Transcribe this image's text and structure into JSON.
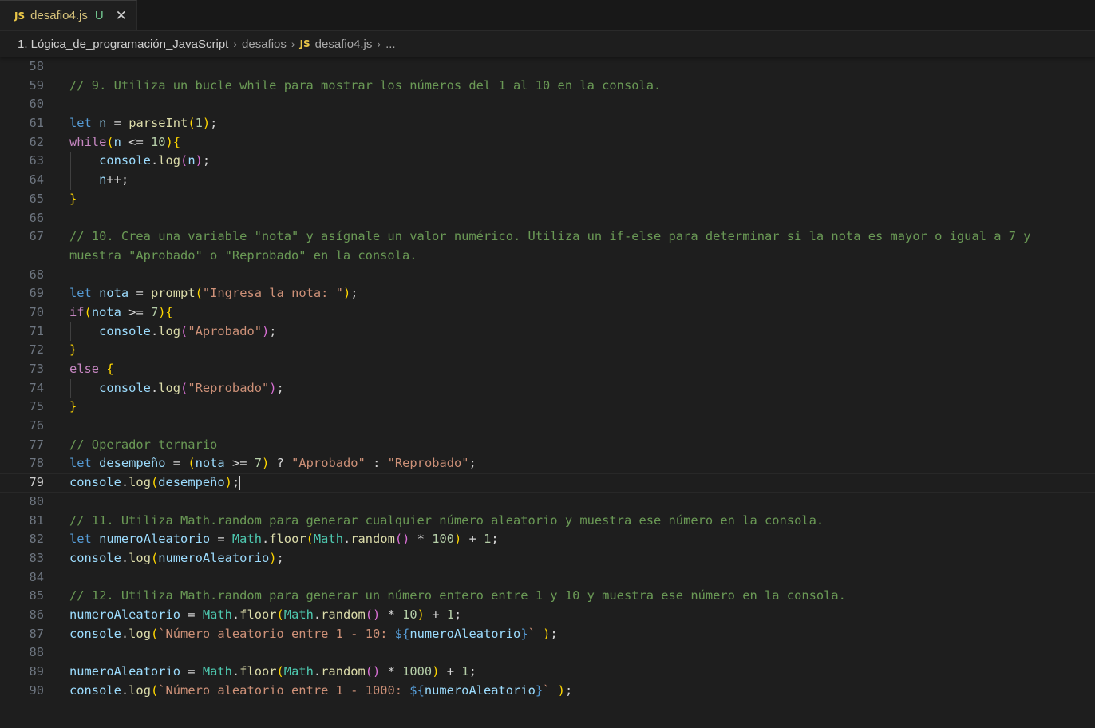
{
  "tab": {
    "icon": "js-file-icon",
    "icon_text": "JS",
    "title": "desafio4.js",
    "status": "U",
    "close_icon": "close-icon",
    "close_glyph": "✕"
  },
  "breadcrumb": {
    "items": [
      "1. Lógica_de_programación_JavaScript",
      "desafios",
      "desafio4.js",
      "..."
    ],
    "separator": "›",
    "file_icon_text": "JS"
  },
  "editor": {
    "current_line": 79,
    "lines": [
      {
        "n": "58",
        "t": []
      },
      {
        "n": "59",
        "t": [
          [
            "cm",
            "// 9. Utiliza un bucle while para mostrar los números del 1 al 10 en la consola."
          ]
        ]
      },
      {
        "n": "60",
        "t": []
      },
      {
        "n": "61",
        "t": [
          [
            "kw",
            "let"
          ],
          [
            "op",
            " "
          ],
          [
            "vr",
            "n"
          ],
          [
            "op",
            " = "
          ],
          [
            "fn",
            "parseInt"
          ],
          [
            "p1",
            "("
          ],
          [
            "nm",
            "1"
          ],
          [
            "p1",
            ")"
          ],
          [
            "op",
            ";"
          ]
        ]
      },
      {
        "n": "62",
        "t": [
          [
            "kc",
            "while"
          ],
          [
            "p1",
            "("
          ],
          [
            "vr",
            "n"
          ],
          [
            "op",
            " <= "
          ],
          [
            "nm",
            "10"
          ],
          [
            "p1",
            ")"
          ],
          [
            "p1",
            "{"
          ]
        ]
      },
      {
        "n": "63",
        "g": 1,
        "t": [
          [
            "op",
            "    "
          ],
          [
            "vr",
            "console"
          ],
          [
            "op",
            "."
          ],
          [
            "fn",
            "log"
          ],
          [
            "p2",
            "("
          ],
          [
            "vr",
            "n"
          ],
          [
            "p2",
            ")"
          ],
          [
            "op",
            ";"
          ]
        ]
      },
      {
        "n": "64",
        "g": 1,
        "t": [
          [
            "op",
            "    "
          ],
          [
            "vr",
            "n"
          ],
          [
            "op",
            "++;"
          ]
        ]
      },
      {
        "n": "65",
        "t": [
          [
            "p1",
            "}"
          ]
        ]
      },
      {
        "n": "66",
        "t": []
      },
      {
        "n": "67",
        "t": [
          [
            "cm",
            "// 10. Crea una variable \"nota\" y asígnale un valor numérico. Utiliza un if-else para determinar si la nota es mayor o igual a 7 y"
          ]
        ]
      },
      {
        "n": "",
        "t": [
          [
            "cm",
            "muestra \"Aprobado\" o \"Reprobado\" en la consola."
          ]
        ]
      },
      {
        "n": "68",
        "t": []
      },
      {
        "n": "69",
        "t": [
          [
            "kw",
            "let"
          ],
          [
            "op",
            " "
          ],
          [
            "vr",
            "nota"
          ],
          [
            "op",
            " = "
          ],
          [
            "fn",
            "prompt"
          ],
          [
            "p1",
            "("
          ],
          [
            "st",
            "\"Ingresa la nota: \""
          ],
          [
            "p1",
            ")"
          ],
          [
            "op",
            ";"
          ]
        ]
      },
      {
        "n": "70",
        "t": [
          [
            "kc",
            "if"
          ],
          [
            "p1",
            "("
          ],
          [
            "vr",
            "nota"
          ],
          [
            "op",
            " >= "
          ],
          [
            "nm",
            "7"
          ],
          [
            "p1",
            ")"
          ],
          [
            "p1",
            "{"
          ]
        ]
      },
      {
        "n": "71",
        "g": 1,
        "t": [
          [
            "op",
            "    "
          ],
          [
            "vr",
            "console"
          ],
          [
            "op",
            "."
          ],
          [
            "fn",
            "log"
          ],
          [
            "p2",
            "("
          ],
          [
            "st",
            "\"Aprobado\""
          ],
          [
            "p2",
            ")"
          ],
          [
            "op",
            ";"
          ]
        ]
      },
      {
        "n": "72",
        "t": [
          [
            "p1",
            "}"
          ]
        ]
      },
      {
        "n": "73",
        "t": [
          [
            "kc",
            "else"
          ],
          [
            "op",
            " "
          ],
          [
            "p1",
            "{"
          ]
        ]
      },
      {
        "n": "74",
        "g": 1,
        "t": [
          [
            "op",
            "    "
          ],
          [
            "vr",
            "console"
          ],
          [
            "op",
            "."
          ],
          [
            "fn",
            "log"
          ],
          [
            "p2",
            "("
          ],
          [
            "st",
            "\"Reprobado\""
          ],
          [
            "p2",
            ")"
          ],
          [
            "op",
            ";"
          ]
        ]
      },
      {
        "n": "75",
        "t": [
          [
            "p1",
            "}"
          ]
        ]
      },
      {
        "n": "76",
        "t": []
      },
      {
        "n": "77",
        "t": [
          [
            "cm",
            "// Operador ternario"
          ]
        ]
      },
      {
        "n": "78",
        "t": [
          [
            "kw",
            "let"
          ],
          [
            "op",
            " "
          ],
          [
            "vr",
            "desempeño"
          ],
          [
            "op",
            " = "
          ],
          [
            "p1",
            "("
          ],
          [
            "vr",
            "nota"
          ],
          [
            "op",
            " >= "
          ],
          [
            "nm",
            "7"
          ],
          [
            "p1",
            ")"
          ],
          [
            "op",
            " ? "
          ],
          [
            "st",
            "\"Aprobado\""
          ],
          [
            "op",
            " : "
          ],
          [
            "st",
            "\"Reprobado\""
          ],
          [
            "op",
            ";"
          ]
        ]
      },
      {
        "n": "79",
        "cur": 1,
        "t": [
          [
            "vr",
            "console"
          ],
          [
            "op",
            "."
          ],
          [
            "fn",
            "log"
          ],
          [
            "p1",
            "("
          ],
          [
            "vr",
            "desempeño"
          ],
          [
            "p1",
            ")"
          ],
          [
            "op",
            ";"
          ]
        ]
      },
      {
        "n": "80",
        "t": []
      },
      {
        "n": "81",
        "t": [
          [
            "cm",
            "// 11. Utiliza Math.random para generar cualquier número aleatorio y muestra ese número en la consola."
          ]
        ]
      },
      {
        "n": "82",
        "t": [
          [
            "kw",
            "let"
          ],
          [
            "op",
            " "
          ],
          [
            "vr",
            "numeroAleatorio"
          ],
          [
            "op",
            " = "
          ],
          [
            "cl",
            "Math"
          ],
          [
            "op",
            "."
          ],
          [
            "fn",
            "floor"
          ],
          [
            "p1",
            "("
          ],
          [
            "cl",
            "Math"
          ],
          [
            "op",
            "."
          ],
          [
            "fn",
            "random"
          ],
          [
            "p2",
            "()"
          ],
          [
            "op",
            " * "
          ],
          [
            "nm",
            "100"
          ],
          [
            "p1",
            ")"
          ],
          [
            "op",
            " + "
          ],
          [
            "nm",
            "1"
          ],
          [
            "op",
            ";"
          ]
        ]
      },
      {
        "n": "83",
        "t": [
          [
            "vr",
            "console"
          ],
          [
            "op",
            "."
          ],
          [
            "fn",
            "log"
          ],
          [
            "p1",
            "("
          ],
          [
            "vr",
            "numeroAleatorio"
          ],
          [
            "p1",
            ")"
          ],
          [
            "op",
            ";"
          ]
        ]
      },
      {
        "n": "84",
        "t": []
      },
      {
        "n": "85",
        "t": [
          [
            "cm",
            "// 12. Utiliza Math.random para generar un número entero entre 1 y 10 y muestra ese número en la consola."
          ]
        ]
      },
      {
        "n": "86",
        "t": [
          [
            "vr",
            "numeroAleatorio"
          ],
          [
            "op",
            " = "
          ],
          [
            "cl",
            "Math"
          ],
          [
            "op",
            "."
          ],
          [
            "fn",
            "floor"
          ],
          [
            "p1",
            "("
          ],
          [
            "cl",
            "Math"
          ],
          [
            "op",
            "."
          ],
          [
            "fn",
            "random"
          ],
          [
            "p2",
            "()"
          ],
          [
            "op",
            " * "
          ],
          [
            "nm",
            "10"
          ],
          [
            "p1",
            ")"
          ],
          [
            "op",
            " + "
          ],
          [
            "nm",
            "1"
          ],
          [
            "op",
            ";"
          ]
        ]
      },
      {
        "n": "87",
        "t": [
          [
            "vr",
            "console"
          ],
          [
            "op",
            "."
          ],
          [
            "fn",
            "log"
          ],
          [
            "p1",
            "("
          ],
          [
            "st",
            "`Número aleatorio entre 1 - 10: "
          ],
          [
            "kw",
            "${"
          ],
          [
            "vr",
            "numeroAleatorio"
          ],
          [
            "kw",
            "}"
          ],
          [
            "st",
            "` "
          ],
          [
            "p1",
            ")"
          ],
          [
            "op",
            ";"
          ]
        ]
      },
      {
        "n": "88",
        "t": []
      },
      {
        "n": "89",
        "t": [
          [
            "vr",
            "numeroAleatorio"
          ],
          [
            "op",
            " = "
          ],
          [
            "cl",
            "Math"
          ],
          [
            "op",
            "."
          ],
          [
            "fn",
            "floor"
          ],
          [
            "p1",
            "("
          ],
          [
            "cl",
            "Math"
          ],
          [
            "op",
            "."
          ],
          [
            "fn",
            "random"
          ],
          [
            "p2",
            "()"
          ],
          [
            "op",
            " * "
          ],
          [
            "nm",
            "1000"
          ],
          [
            "p1",
            ")"
          ],
          [
            "op",
            " + "
          ],
          [
            "nm",
            "1"
          ],
          [
            "op",
            ";"
          ]
        ]
      },
      {
        "n": "90",
        "t": [
          [
            "vr",
            "console"
          ],
          [
            "op",
            "."
          ],
          [
            "fn",
            "log"
          ],
          [
            "p1",
            "("
          ],
          [
            "st",
            "`Número aleatorio entre 1 - 1000: "
          ],
          [
            "kw",
            "${"
          ],
          [
            "vr",
            "numeroAleatorio"
          ],
          [
            "kw",
            "}"
          ],
          [
            "st",
            "` "
          ],
          [
            "p1",
            ")"
          ],
          [
            "op",
            ";"
          ]
        ]
      }
    ]
  }
}
